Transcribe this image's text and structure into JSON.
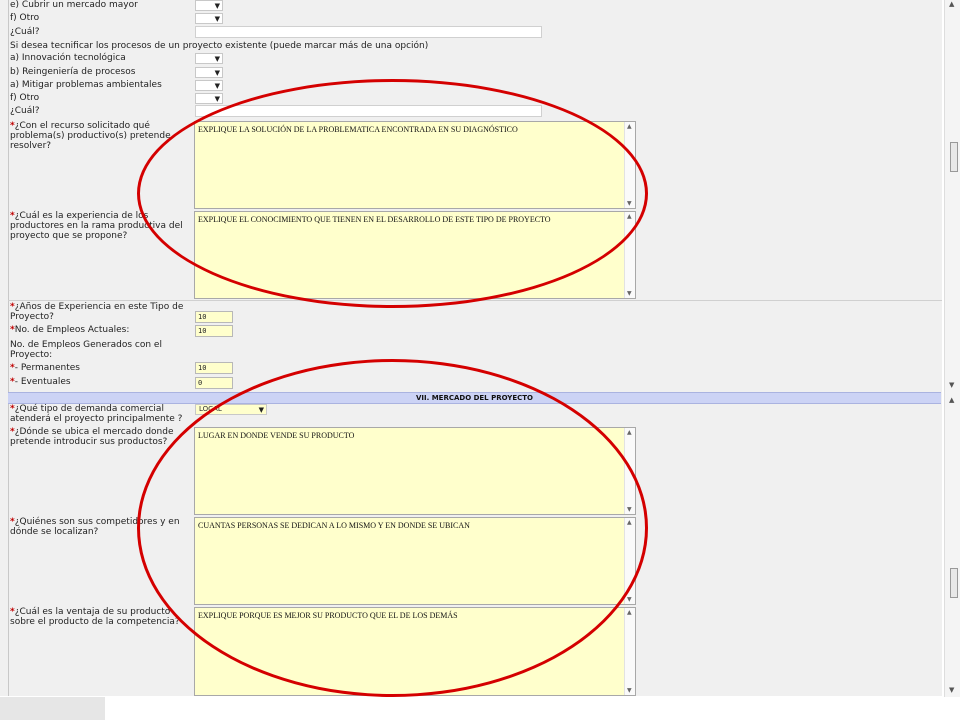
{
  "form": {
    "rows_top": [
      {
        "label": "e) Cubrir un mercado mayor"
      },
      {
        "label": "f) Otro"
      }
    ],
    "cual_1": "¿Cuál?",
    "tecnificar_question": "Si desea tecnificar los procesos de un proyecto existente (puede marcar más de una opción)",
    "tecnificar_options": [
      {
        "label": "a) Innovación tecnológica"
      },
      {
        "label": "b) Reingeniería de procesos"
      },
      {
        "label": "a) Mitigar problemas ambientales"
      },
      {
        "label": "f) Otro"
      }
    ],
    "cual_2": "¿Cuál?",
    "required_mark": "*",
    "q_problema": {
      "label": "¿Con el recurso solicitado qué problema(s) productivo(s) pretende resolver?",
      "value": "EXPLIQUE LA SOLUCIÓN DE LA PROBLEMATICA ENCONTRADA EN SU DIAGNÓSTICO"
    },
    "q_experiencia": {
      "label": "¿Cuál es la experiencia de los productores en la rama productiva del proyecto que se propone?",
      "value": "EXPLIQUE EL CONOCIMIENTO QUE TIENEN EN EL DESARROLLO DE ESTE TIPO DE PROYECTO"
    },
    "q_anios": {
      "label": "¿Años de Experiencia en este Tipo de Proyecto?",
      "value": "10"
    },
    "q_empleos_actuales": {
      "label": "No. de Empleos Actuales:",
      "value": "10"
    },
    "empleos_generados_label": "No. de Empleos Generados con el Proyecto:",
    "q_permanentes": {
      "label": "- Permanentes",
      "value": "10"
    },
    "q_eventuales": {
      "label": "- Eventuales",
      "value": "0"
    },
    "section_title": "VII. MERCADO DEL PROYECTO",
    "q_demanda": {
      "label": "¿Qué tipo de demanda comercial atenderá el proyecto principalmente ?",
      "value": "LOCAL"
    },
    "q_ubica": {
      "label": "¿Dónde se ubica el mercado donde pretende introducir sus productos?",
      "value": "LUGAR EN DONDE VENDE SU PRODUCTO"
    },
    "q_competidores": {
      "label": "¿Quiénes son sus competidores y en dónde se localizan?",
      "value": "CUANTAS PERSONAS SE DEDICAN A LO MISMO Y EN DONDE SE UBICAN"
    },
    "q_ventaja": {
      "label": "¿Cuál es la ventaja de su producto sobre el producto de la competencia?",
      "value": "EXPLIQUE PORQUE ES MEJOR SU PRODUCTO QUE EL DE LOS DEMÁS"
    }
  },
  "icons": {
    "dropdown": "dropdown-arrow-icon",
    "scroll_up": "scroll-up-icon",
    "scroll_down": "scroll-down-icon"
  },
  "colors": {
    "highlight_ellipse": "#d40000",
    "field_bg": "#ffffcc",
    "section_bg": "#ccd3f5",
    "required": "#c00000"
  }
}
